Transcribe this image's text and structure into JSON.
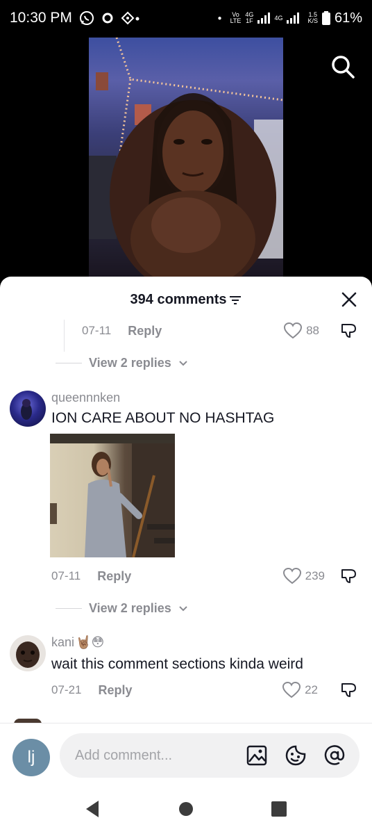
{
  "status_bar": {
    "time": "10:30 PM",
    "network_1_top": "Vo",
    "network_1_bottom": "LTE",
    "network_2_top": "4G",
    "network_2_bottom": "1F",
    "network_3": "4G",
    "speed_top": "1.5",
    "speed_bottom": "K/S",
    "battery": "61%"
  },
  "sheet": {
    "comments_count": "394 comments"
  },
  "comments": [
    {
      "date": "07-11",
      "reply_label": "Reply",
      "likes": "88",
      "view_replies": "View 2 replies"
    },
    {
      "username": "queennnken",
      "text": "ION CARE ABOUT NO HASHTAG",
      "date": "07-11",
      "reply_label": "Reply",
      "likes": "239",
      "view_replies": "View 2 replies"
    },
    {
      "username": "kani",
      "username_emojis": "🤘🏽😳",
      "text": "wait this comment sections kinda weird",
      "date": "07-21",
      "reply_label": "Reply",
      "likes": "22"
    }
  ],
  "input": {
    "avatar_initials": "lj",
    "placeholder": "Add comment..."
  },
  "icons": {
    "search": "search-icon",
    "filter": "filter-icon",
    "close": "close-icon",
    "heart": "heart-icon",
    "dislike": "dislike-icon",
    "chevron": "chevron-down-icon",
    "image": "image-icon",
    "emoji": "emoji-icon",
    "mention": "mention-icon",
    "back": "back-icon",
    "home": "home-icon",
    "recents": "recents-icon"
  },
  "colors": {
    "text_primary": "#161823",
    "text_secondary": "#8a8b91",
    "sheet_bg": "#ffffff"
  }
}
